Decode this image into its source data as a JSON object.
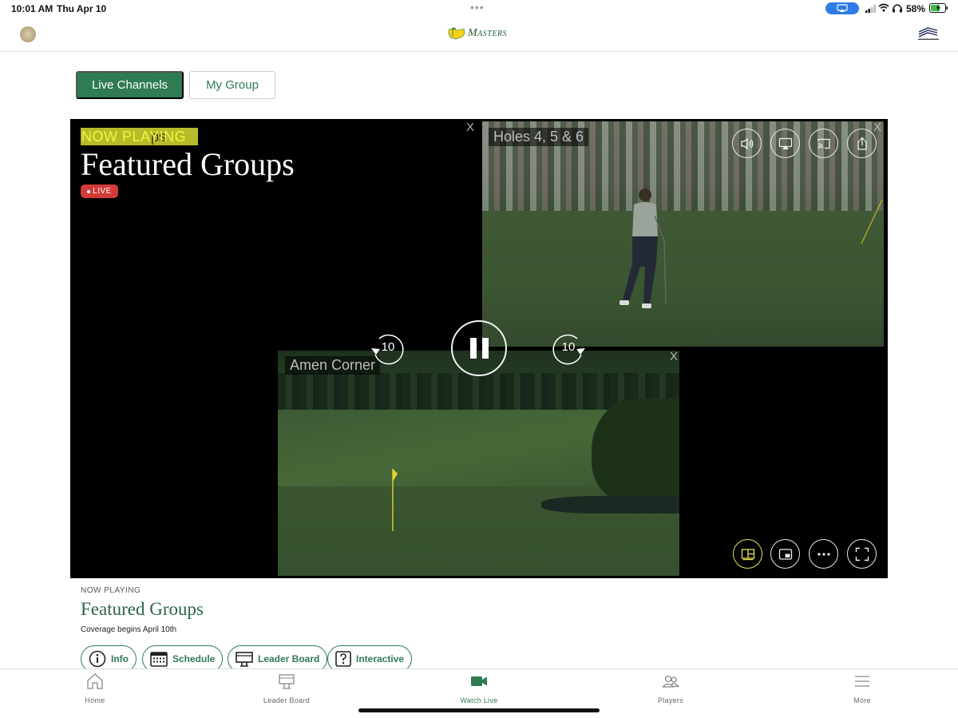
{
  "status_bar": {
    "time": "10:01 AM",
    "date": "Thu Apr 10",
    "battery_percent": "58%",
    "dots": "•••"
  },
  "header": {
    "brand_name": "Masters"
  },
  "channel_tabs": {
    "live_channels": "Live Channels",
    "my_group": "My Group"
  },
  "player": {
    "now_playing_label": "NOW PLAYING",
    "now_playing_ghost": "ps",
    "title": "Featured Groups",
    "live_badge": "LIVE",
    "feeds": [
      {
        "label": "Holes 4, 5 & 6"
      },
      {
        "label": "Amen Corner"
      }
    ],
    "close_label": "X",
    "skip_back_seconds": "10",
    "skip_forward_seconds": "10"
  },
  "now_playing_info": {
    "label": "NOW PLAYING",
    "title": "Featured Groups",
    "subtitle": "Coverage begins April 10th"
  },
  "action_buttons": {
    "info": "Info",
    "schedule": "Schedule",
    "leader_board": "Leader Board",
    "interactive": "Interactive"
  },
  "tab_bar": {
    "home": "Home",
    "leader_board": "Leader Board",
    "watch_live": "Watch Live",
    "players": "Players",
    "more": "More"
  },
  "colors": {
    "brand_green": "#2f7b52",
    "live_red": "#d33b38",
    "highlight_yellow": "#f1f53f"
  }
}
